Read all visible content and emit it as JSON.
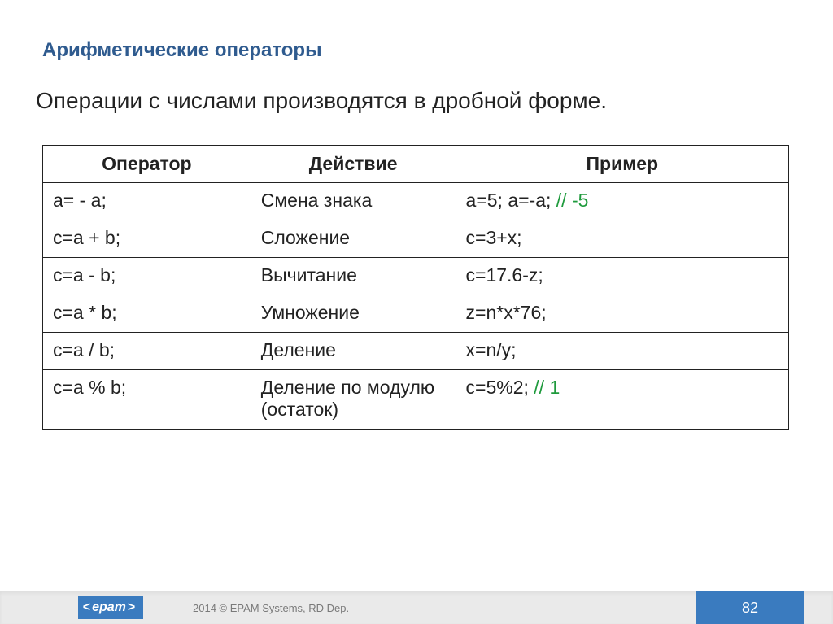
{
  "title": "Арифметические операторы",
  "subtitle": "Операции с числами производятся в дробной форме.",
  "headers": {
    "op": "Оператор",
    "act": "Действие",
    "ex": "Пример"
  },
  "rows": [
    {
      "op": "a= - a;",
      "act": "Смена знака",
      "ex": "a=5; a=-a; ",
      "comment": "// -5"
    },
    {
      "op": "c=a + b;",
      "act": "Сложение",
      "ex": "c=3+x;",
      "comment": ""
    },
    {
      "op": "c=a - b;",
      "act": "Вычитание",
      "ex": "c=17.6-z;",
      "comment": ""
    },
    {
      "op": "c=a * b;",
      "act": "Умножение",
      "ex": "z=n*x*76;",
      "comment": ""
    },
    {
      "op": "c=a / b;",
      "act": "Деление",
      "ex": "x=n/y;",
      "comment": ""
    },
    {
      "op": "c=a % b;",
      "act": "Деление по модулю (остаток)",
      "ex": "c=5%2; ",
      "comment": "// 1"
    }
  ],
  "footer": {
    "logo_text": "epam",
    "copyright": "2014 © EPAM Systems, RD Dep.",
    "page": "82"
  },
  "chart_data": {
    "type": "table",
    "title": "Арифметические операторы",
    "columns": [
      "Оператор",
      "Действие",
      "Пример"
    ],
    "rows": [
      [
        "a= - a;",
        "Смена знака",
        "a=5; a=-a; // -5"
      ],
      [
        "c=a + b;",
        "Сложение",
        "c=3+x;"
      ],
      [
        "c=a - b;",
        "Вычитание",
        "c=17.6-z;"
      ],
      [
        "c=a * b;",
        "Умножение",
        "z=n*x*76;"
      ],
      [
        "c=a / b;",
        "Деление",
        "x=n/y;"
      ],
      [
        "c=a % b;",
        "Деление по модулю (остаток)",
        "c=5%2; // 1"
      ]
    ]
  }
}
